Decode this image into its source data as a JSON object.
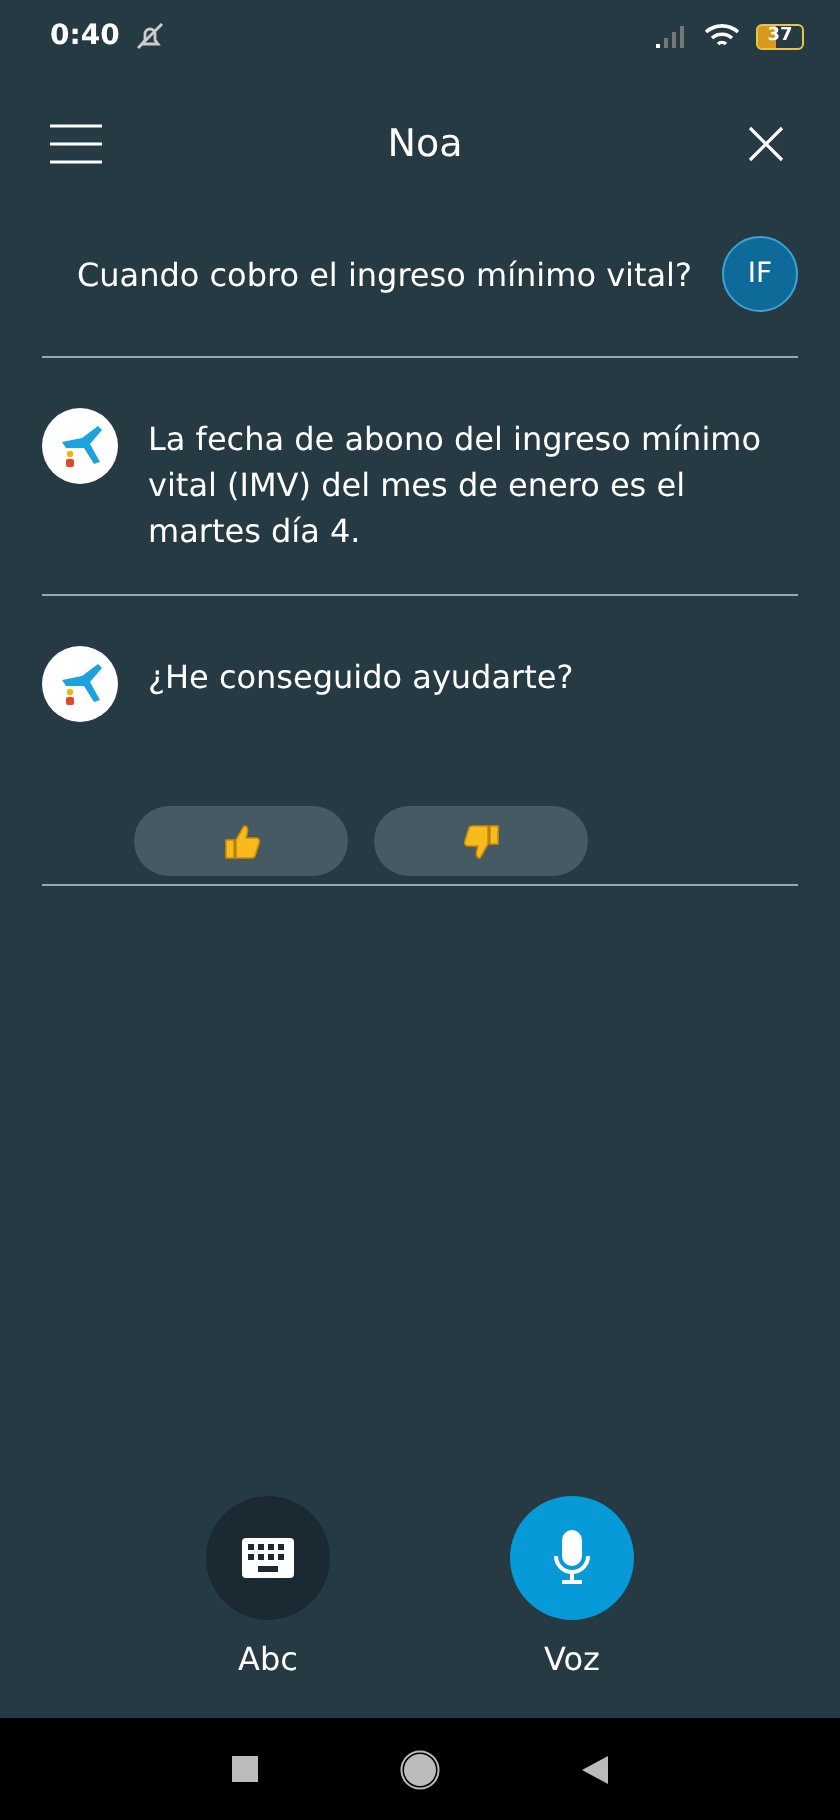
{
  "status_bar": {
    "time": "0:40",
    "battery": "37"
  },
  "header": {
    "title": "Noa"
  },
  "messages": [
    {
      "kind": "user",
      "text": "Cuando cobro el ingreso mínimo vital?",
      "avatar": "IF"
    },
    {
      "kind": "bot",
      "text": "La fecha de abono del ingreso mínimo vital (IMV) del mes de enero es el martes día 4."
    },
    {
      "kind": "bot",
      "text": "¿He conseguido ayudarte?",
      "feedback": true
    }
  ],
  "input_modes": [
    {
      "kind": "keyboard",
      "label": "Abc",
      "selected": false
    },
    {
      "kind": "voice",
      "label": "Voz",
      "selected": true
    }
  ]
}
